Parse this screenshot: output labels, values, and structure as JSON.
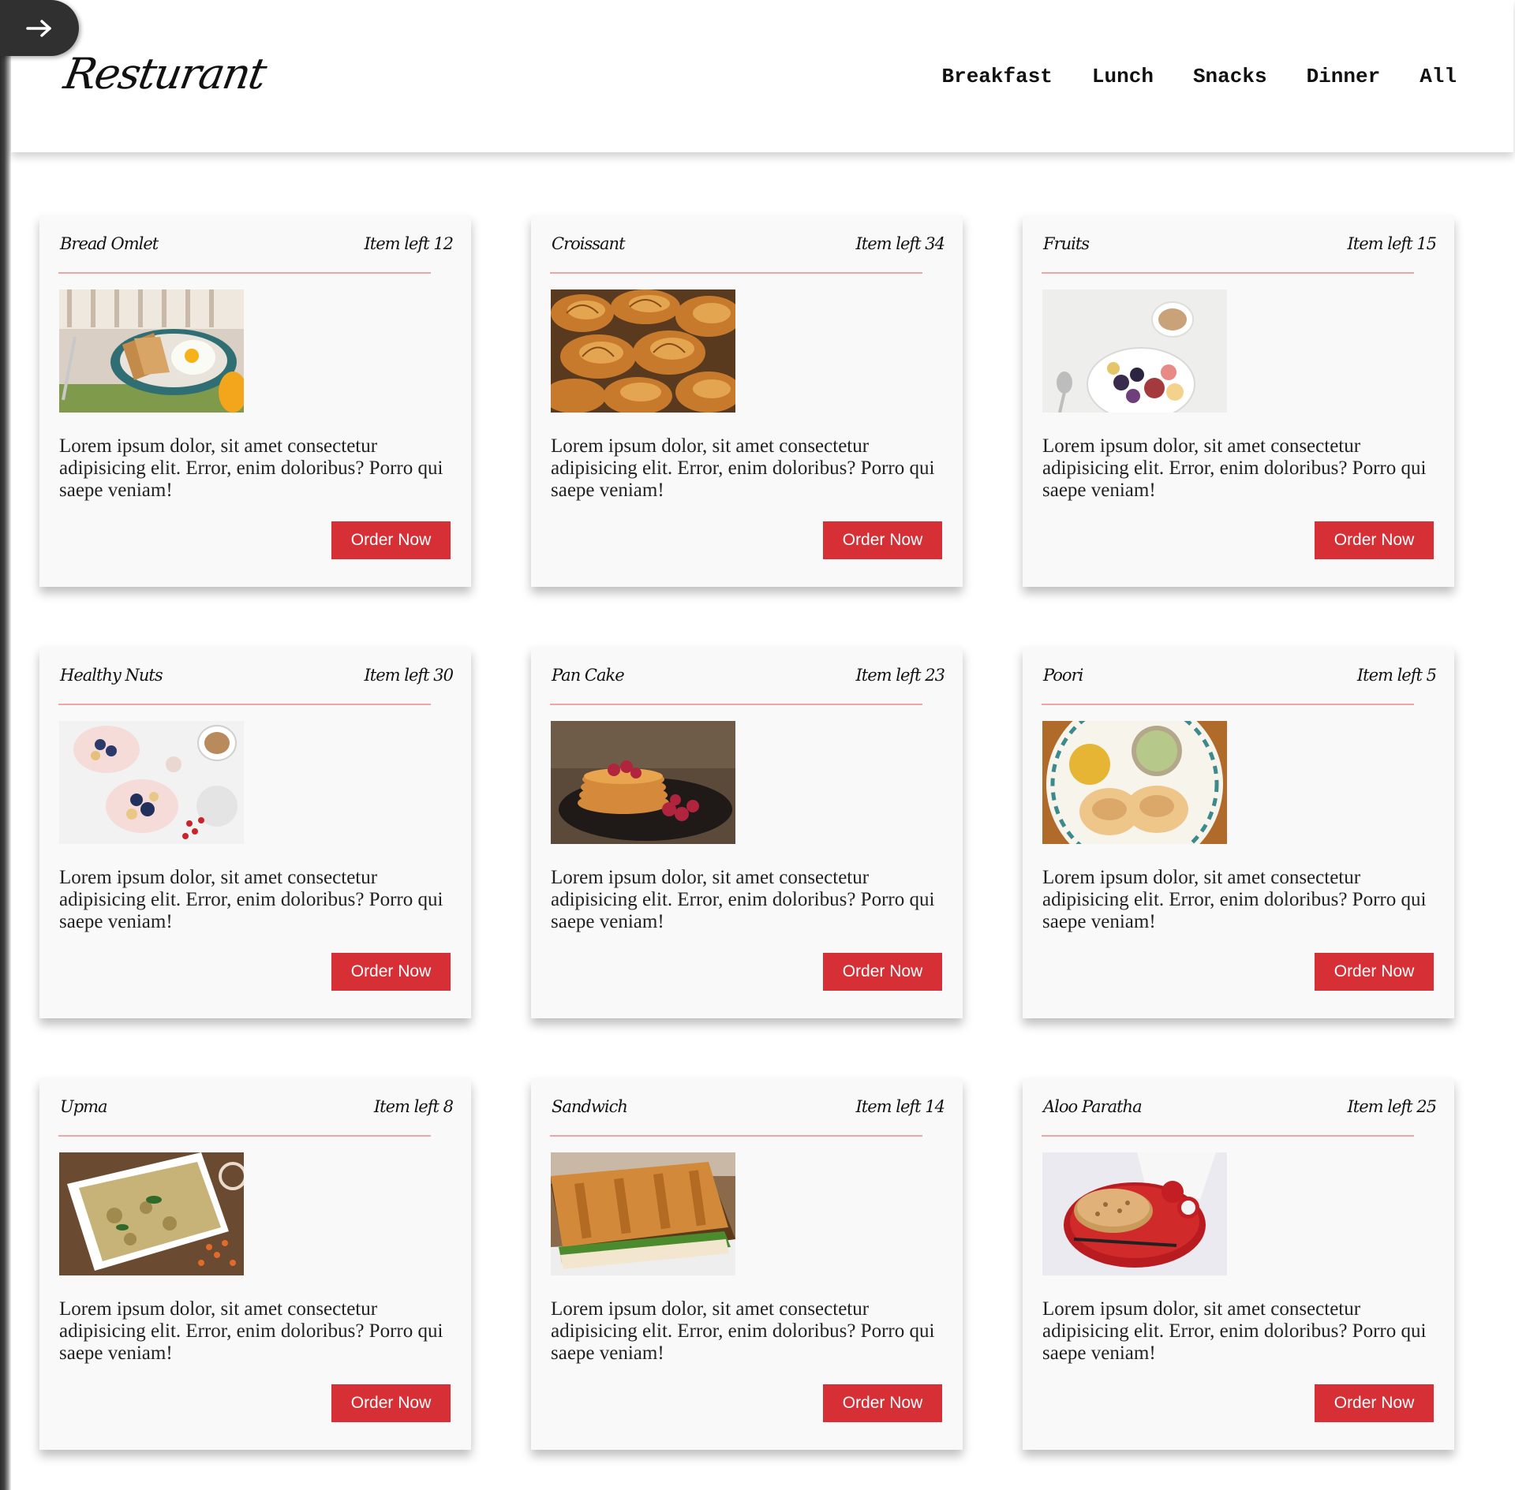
{
  "header": {
    "brand": "Resturant",
    "nav": [
      "Breakfast",
      "Lunch",
      "Snacks",
      "Dinner",
      "All"
    ]
  },
  "toggle": {
    "icon": "arrow-right-icon"
  },
  "colors": {
    "accent": "#d63036",
    "divider": "#f0a4a4",
    "card_bg": "#f9f9f9",
    "toggle_bg": "#303030"
  },
  "cards": [
    {
      "title": "Bread Omlet",
      "stock": "Item left 12",
      "image": "bread-omelet-photo",
      "description": "Lorem ipsum dolor, sit amet consectetur adipisicing elit. Error, enim doloribus? Porro qui saepe veniam!",
      "button": "Order Now"
    },
    {
      "title": "Croissant",
      "stock": "Item left 34",
      "image": "croissant-photo",
      "description": "Lorem ipsum dolor, sit amet consectetur adipisicing elit. Error, enim doloribus? Porro qui saepe veniam!",
      "button": "Order Now"
    },
    {
      "title": "Fruits",
      "stock": "Item left 15",
      "image": "fruits-bowl-photo",
      "description": "Lorem ipsum dolor, sit amet consectetur adipisicing elit. Error, enim doloribus? Porro qui saepe veniam!",
      "button": "Order Now"
    },
    {
      "title": "Healthy Nuts",
      "stock": "Item left 30",
      "image": "healthy-nuts-photo",
      "description": "Lorem ipsum dolor, sit amet consectetur adipisicing elit. Error, enim doloribus? Porro qui saepe veniam!",
      "button": "Order Now"
    },
    {
      "title": "Pan Cake",
      "stock": "Item left 23",
      "image": "pancake-photo",
      "description": "Lorem ipsum dolor, sit amet consectetur adipisicing elit. Error, enim doloribus? Porro qui saepe veniam!",
      "button": "Order Now"
    },
    {
      "title": "Poori",
      "stock": "Item left 5",
      "image": "poori-photo",
      "description": "Lorem ipsum dolor, sit amet consectetur adipisicing elit. Error, enim doloribus? Porro qui saepe veniam!",
      "button": "Order Now"
    },
    {
      "title": "Upma",
      "stock": "Item left 8",
      "image": "upma-photo",
      "description": "Lorem ipsum dolor, sit amet consectetur adipisicing elit. Error, enim doloribus? Porro qui saepe veniam!",
      "button": "Order Now"
    },
    {
      "title": "Sandwich",
      "stock": "Item left 14",
      "image": "sandwich-photo",
      "description": "Lorem ipsum dolor, sit amet consectetur adipisicing elit. Error, enim doloribus? Porro qui saepe veniam!",
      "button": "Order Now"
    },
    {
      "title": "Aloo Paratha",
      "stock": "Item left 25",
      "image": "aloo-paratha-photo",
      "description": "Lorem ipsum dolor, sit amet consectetur adipisicing elit. Error, enim doloribus? Porro qui saepe veniam!",
      "button": "Order Now"
    }
  ]
}
